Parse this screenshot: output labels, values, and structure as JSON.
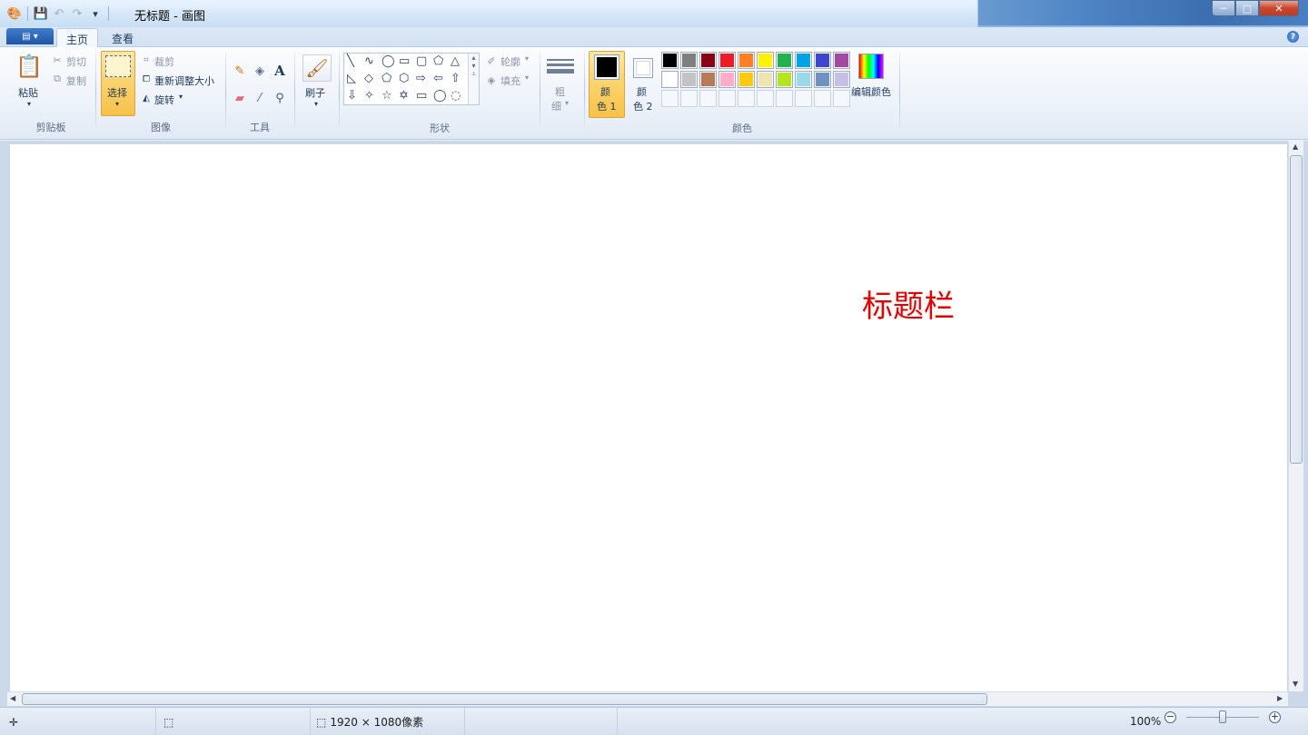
{
  "window": {
    "title": "无标题 - 画图",
    "controls": {
      "minimize": "─",
      "maximize": "□",
      "close": "✕"
    }
  },
  "quick_access": {
    "app_icon": "paint-palette-icon",
    "save": "save-icon",
    "undo": "undo-icon",
    "redo": "redo-icon",
    "customize": "▾"
  },
  "tabs": [
    {
      "label": "主页",
      "active": true
    },
    {
      "label": "查看",
      "active": false
    }
  ],
  "file_menu": "▤ ▾",
  "ribbon": {
    "clipboard": {
      "group_label": "剪贴板",
      "paste": "粘贴",
      "cut": "剪切",
      "copy": "复制"
    },
    "image": {
      "group_label": "图像",
      "select": "选择",
      "crop": "裁剪",
      "resize": "重新调整大小",
      "rotate": "旋转"
    },
    "tools": {
      "group_label": "工具"
    },
    "brushes": {
      "label": "刷子"
    },
    "shapes": {
      "group_label": "形状",
      "outline": "轮廓",
      "fill": "填充",
      "row1": [
        "╲",
        "∿",
        "◯",
        "▭",
        "▢",
        "⬠",
        "△"
      ],
      "row2": [
        "◺",
        "◇",
        "⬠",
        "⬡",
        "⇨",
        "⇦",
        "⇧"
      ],
      "row3": [
        "⇩",
        "✧",
        "☆",
        "✡",
        "▭",
        "◯",
        "◌"
      ]
    },
    "size": {
      "label_1": "粗",
      "label_2": "细"
    },
    "colors": {
      "group_label": "颜色",
      "color1_a": "颜",
      "color1_b": "色 1",
      "color2_a": "颜",
      "color2_b": "色 2",
      "edit": "编辑颜色",
      "color1": "#000000",
      "color2": "#ffffff",
      "palette_row1": [
        "#000000",
        "#7f7f7f",
        "#880015",
        "#ed1c24",
        "#ff7f27",
        "#fff200",
        "#22b14c",
        "#00a2e8",
        "#3f48cc",
        "#a349a4"
      ],
      "palette_row2": [
        "#ffffff",
        "#c3c3c3",
        "#b97a57",
        "#ffaec9",
        "#ffc90e",
        "#efe4b0",
        "#b5e61d",
        "#99d9ea",
        "#7092be",
        "#c8bfe7"
      ]
    }
  },
  "canvas": {
    "annotation": "标题栏"
  },
  "status": {
    "dimensions": "1920 × 1080像素",
    "zoom": "100%",
    "zoom_out": "−",
    "zoom_in": "+"
  }
}
